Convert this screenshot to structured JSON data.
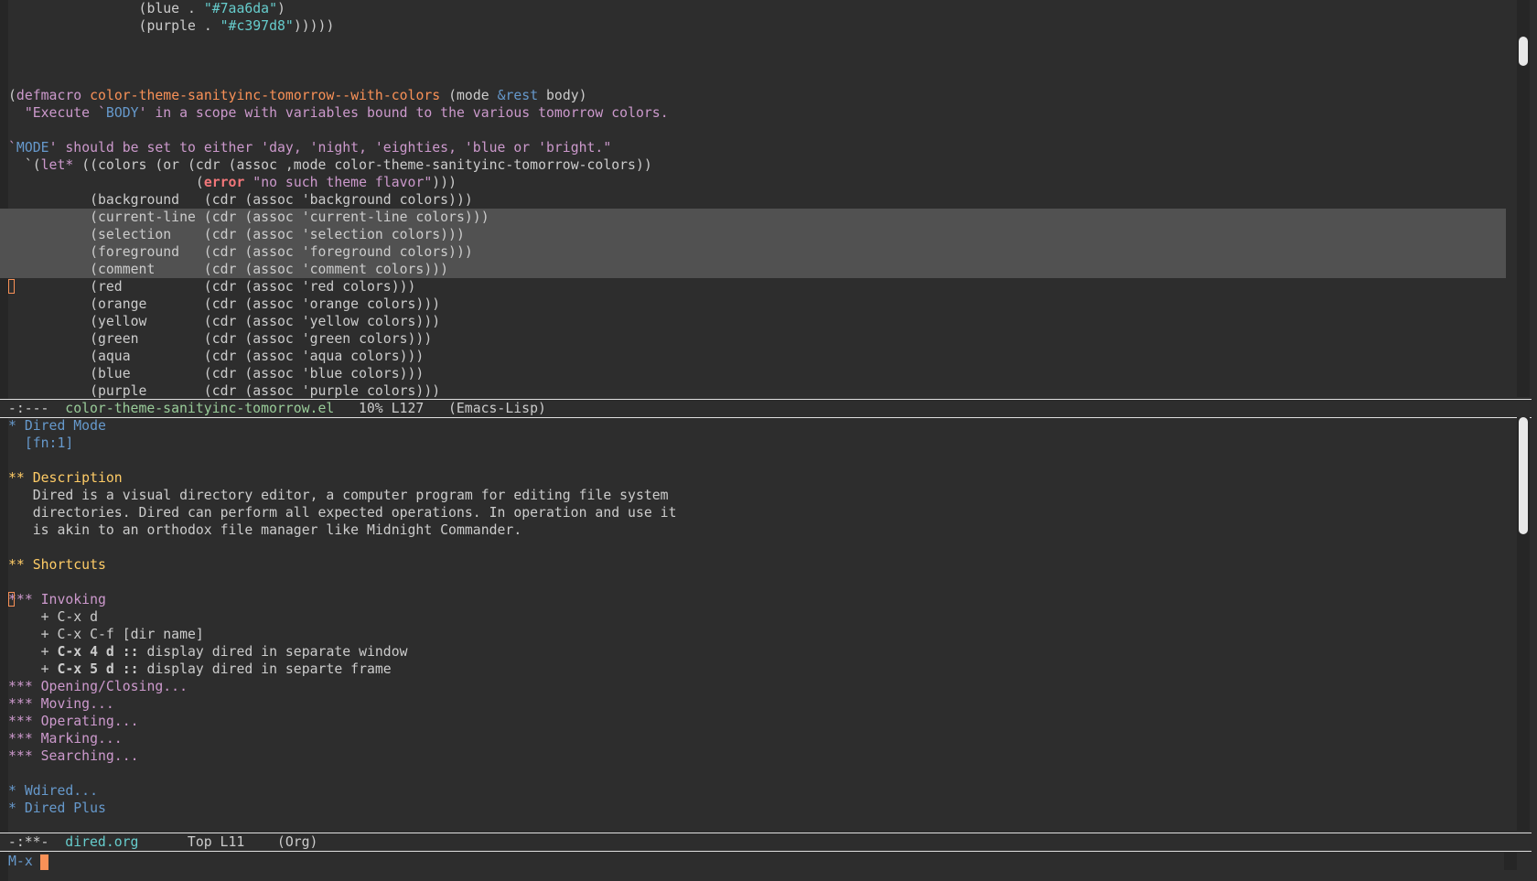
{
  "code_buffer": {
    "lines": [
      [
        {
          "t": "                "
        },
        {
          "t": "(blue . "
        },
        {
          "t": "\"#7aa6da\"",
          "c": "hex"
        },
        {
          "t": ")"
        }
      ],
      [
        {
          "t": "                "
        },
        {
          "t": "(purple . "
        },
        {
          "t": "\"#c397d8\"",
          "c": "hex"
        },
        {
          "t": ")))))"
        }
      ],
      [],
      [],
      [],
      [
        {
          "t": "("
        },
        {
          "t": "defmacro",
          "c": "kw"
        },
        {
          "t": " "
        },
        {
          "t": "color-theme-sanityinc-tomorrow--with-colors",
          "c": "fn"
        },
        {
          "t": " (mode "
        },
        {
          "t": "&rest",
          "c": "sym"
        },
        {
          "t": " body)"
        }
      ],
      [
        {
          "t": "  "
        },
        {
          "t": "\"Execute `",
          "c": "str"
        },
        {
          "t": "BODY",
          "c": "sym"
        },
        {
          "t": "' in a scope with variables bound to the various tomorrow colors.",
          "c": "str"
        }
      ],
      [],
      [
        {
          "t": "`",
          "c": "str"
        },
        {
          "t": "MODE",
          "c": "sym"
        },
        {
          "t": "' should be set to either 'day, 'night, 'eighties, 'blue or 'bright.\"",
          "c": "str"
        }
      ],
      [
        {
          "t": "  `("
        },
        {
          "t": "let*",
          "c": "kw"
        },
        {
          "t": " ((colors (or (cdr (assoc ,mode color-theme-sanityinc-tomorrow-colors))"
        }
      ],
      [
        {
          "t": "                       ("
        },
        {
          "t": "error",
          "c": "err"
        },
        {
          "t": " "
        },
        {
          "t": "\"no such theme flavor\"",
          "c": "str"
        },
        {
          "t": ")))"
        }
      ],
      [
        {
          "t": "          (background   (cdr (assoc 'background colors)))"
        }
      ],
      [
        {
          "t": "          (current-line (cdr (assoc 'current-line colors)))"
        }
      ],
      [
        {
          "t": "          (selection    (cdr (assoc 'selection colors)))"
        }
      ],
      [
        {
          "t": "          (foreground   (cdr (assoc 'foreground colors)))"
        }
      ],
      [
        {
          "t": "          (comment      (cdr (assoc 'comment colors)))"
        }
      ],
      [
        {
          "t": "          (red          (cdr (assoc 'red colors)))"
        }
      ],
      [
        {
          "t": "          (orange       (cdr (assoc 'orange colors)))"
        }
      ],
      [
        {
          "t": "          (yellow       (cdr (assoc 'yellow colors)))"
        }
      ],
      [
        {
          "t": "          (green        (cdr (assoc 'green colors)))"
        }
      ],
      [
        {
          "t": "          (aqua         (cdr (assoc 'aqua colors)))"
        }
      ],
      [
        {
          "t": "          (blue         (cdr (assoc 'blue colors)))"
        }
      ],
      [
        {
          "t": "          (purple       (cdr (assoc 'purple colors)))"
        }
      ]
    ],
    "highlighted_lines": [
      12,
      13,
      14,
      15
    ],
    "cursor_line": 16
  },
  "org_buffer": {
    "lines": [
      [
        {
          "t": "* Dired Mode",
          "c": "blue"
        }
      ],
      [
        {
          "t": "  [fn:1]",
          "c": "blue"
        }
      ],
      [],
      [
        {
          "t": "** Description",
          "c": "yellow"
        }
      ],
      [
        {
          "t": "   Dired is a visual directory editor, a computer program for editing file system"
        }
      ],
      [
        {
          "t": "   directories. Dired can perform all expected operations. In operation and use it"
        }
      ],
      [
        {
          "t": "   is akin to an orthodox file manager like Midnight Commander."
        }
      ],
      [],
      [
        {
          "t": "** Shortcuts",
          "c": "yellow"
        }
      ],
      [],
      [
        {
          "t": "*** Invoking",
          "c": "purple"
        }
      ],
      [
        {
          "t": "    + C-x d"
        }
      ],
      [
        {
          "t": "    + C-x C-f [dir name]"
        }
      ],
      [
        {
          "t": "    + "
        },
        {
          "t": "C-x 4 d ::",
          "c": "bold"
        },
        {
          "t": " display dired in separate window"
        }
      ],
      [
        {
          "t": "    + "
        },
        {
          "t": "C-x 5 d ::",
          "c": "bold"
        },
        {
          "t": " display dired in separte frame"
        }
      ],
      [
        {
          "t": "*** Opening/Closing...",
          "c": "purple"
        }
      ],
      [
        {
          "t": "*** Moving...",
          "c": "purple"
        }
      ],
      [
        {
          "t": "*** Operating...",
          "c": "purple"
        }
      ],
      [
        {
          "t": "*** Marking...",
          "c": "purple"
        }
      ],
      [
        {
          "t": "*** Searching...",
          "c": "purple"
        }
      ],
      [],
      [
        {
          "t": "* Wdired...",
          "c": "blue"
        }
      ],
      [
        {
          "t": "* Dired Plus",
          "c": "blue"
        }
      ]
    ],
    "cursor_line": 10
  },
  "modeline_top": {
    "status": " -:---  ",
    "buffer_name": "color-theme-sanityinc-tomorrow.el",
    "position": "   10% L127   ",
    "mode": "(Emacs-Lisp)"
  },
  "modeline_bottom": {
    "status": " -:**-  ",
    "buffer_name": "dired.org",
    "position": "      Top L11    ",
    "mode": "(Org)"
  },
  "minibuffer": {
    "prompt": "M-x"
  }
}
